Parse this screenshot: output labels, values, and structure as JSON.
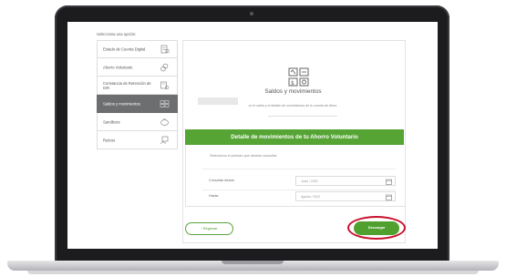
{
  "sidebar": {
    "heading": "Selecciona una opción:",
    "items": [
      {
        "label": "Estado de Cuenta Digital",
        "icon": "document-icon",
        "active": false
      },
      {
        "label": "Ahorro Voluntario",
        "icon": "coins-icon",
        "active": false
      },
      {
        "label": "Constancia de Retención de ISR",
        "icon": "certificate-icon",
        "active": false
      },
      {
        "label": "Saldos y movimientos",
        "icon": "balance-icon",
        "active": true
      },
      {
        "label": "Sandboxs",
        "icon": "piggy-bank-icon",
        "active": false
      },
      {
        "label": "Retiros",
        "icon": "withdrawal-icon",
        "active": false
      }
    ]
  },
  "main": {
    "title": "Saldos y movimientos",
    "description": "ce el saldo y el detalle de movimientos de tu cuenta de Afore.",
    "section_title": "Detalle de movimientos de tu Ahorro Voluntario",
    "period_hint": "Selecciona el periodo que deseas consultar.",
    "fields": [
      {
        "label": "Consultar desde:",
        "value": "Junio / 2020"
      },
      {
        "label": "Hasta:",
        "value": "Agosto / 2020"
      }
    ]
  },
  "actions": {
    "back_label": "‹ Regresar",
    "download_label": "Descargar"
  },
  "colors": {
    "accent_green": "#55a434",
    "active_menu": "#6d6e70",
    "highlight_ring": "#c8102e"
  }
}
